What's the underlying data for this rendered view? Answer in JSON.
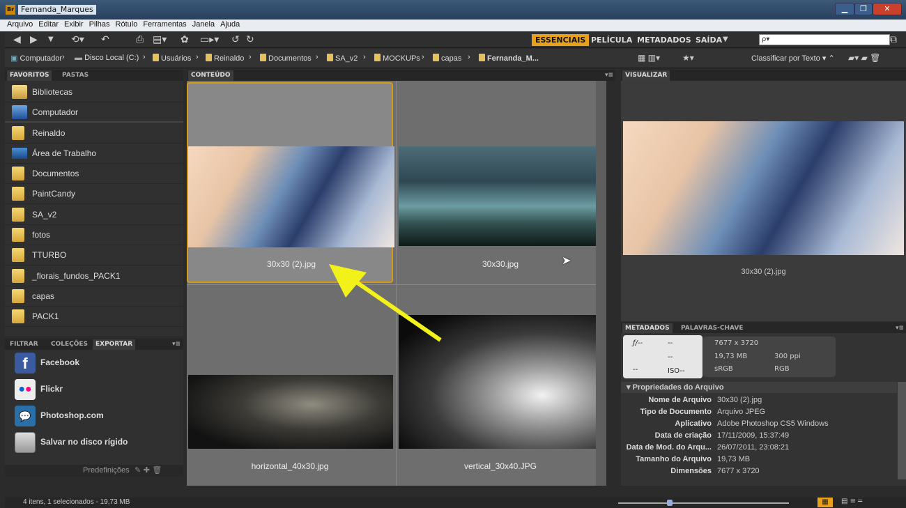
{
  "window": {
    "title": "Fernanda_Marques",
    "app_logo": "Br"
  },
  "menu": [
    "Arquivo",
    "Editar",
    "Exibir",
    "Pilhas",
    "Rótulo",
    "Ferramentas",
    "Janela",
    "Ajuda"
  ],
  "workspaces": {
    "essenciais": "ESSENCIAIS",
    "pelicula": "PELÍCULA",
    "metadados": "METADADOS",
    "saida": "SAÍDA"
  },
  "search": {
    "placeholder": "ρ▾"
  },
  "path": [
    "Computador",
    "Disco Local (C:)",
    "Usuários",
    "Reinaldo",
    "Documentos",
    "SA_v2",
    "MOCKUPs",
    "capas",
    "Fernanda_M..."
  ],
  "sort_label": "Classificar por Texto",
  "left_tabs": {
    "favoritos": "FAVORITOS",
    "pastas": "PASTAS"
  },
  "favorites": [
    "Bibliotecas",
    "Computador",
    "Reinaldo",
    "Área de Trabalho",
    "Documentos",
    "PaintCandy",
    "SA_v2",
    "fotos",
    "TTURBO",
    "_florais_fundos_PACK1",
    "capas",
    "PACK1"
  ],
  "lower_tabs": {
    "filtrar": "FILTRAR",
    "colecoes": "COLEÇÕES",
    "exportar": "EXPORTAR"
  },
  "export_items": [
    "Facebook",
    "Flickr",
    "Photoshop.com",
    "Salvar no disco rígido"
  ],
  "presets_label": "Predefinições",
  "content_tab": "CONTEÚDO",
  "thumbnails": [
    "30x30 (2).jpg",
    "30x30.jpg",
    "horizontal_40x30.jpg",
    "vertical_30x40.JPG"
  ],
  "preview": {
    "tab": "VISUALIZAR",
    "caption": "30x30 (2).jpg"
  },
  "meta_tabs": {
    "metadados": "METADADOS",
    "palavras": "PALAVRAS-CHAVE"
  },
  "camera": {
    "f": "ƒ/--",
    "a": "--",
    "b": "--",
    "c": "--",
    "iso": "ISO--",
    "dims": "7677 x 3720",
    "size": "19,73 MB",
    "ppi": "300 ppi",
    "space": "sRGB",
    "mode": "RGB"
  },
  "file_props_title": "Propriedades do Arquivo",
  "file_props": [
    {
      "k": "Nome de Arquivo",
      "v": "30x30 (2).jpg"
    },
    {
      "k": "Tipo de Documento",
      "v": "Arquivo JPEG"
    },
    {
      "k": "Aplicativo",
      "v": "Adobe Photoshop CS5 Windows"
    },
    {
      "k": "Data de criação",
      "v": "17/11/2009, 15:37:49"
    },
    {
      "k": "Data de Mod. do Arqu...",
      "v": "26/07/2011, 23:08:21"
    },
    {
      "k": "Tamanho do Arquivo",
      "v": "19,73 MB"
    },
    {
      "k": "Dimensões",
      "v": "7677 x 3720"
    }
  ],
  "status": "4 itens, 1 selecionados - 19,73 MB",
  "colors": {
    "accent": "#e9a01a",
    "arrow": "#f2f21a"
  }
}
